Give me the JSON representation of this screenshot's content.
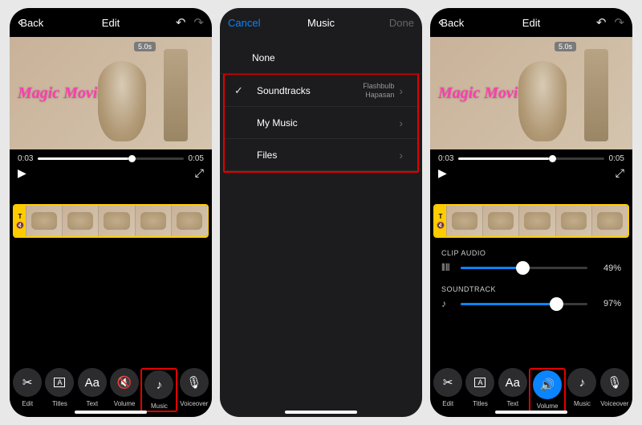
{
  "nav": {
    "back": "Back",
    "edit": "Edit",
    "music": "Music",
    "cancel": "Cancel",
    "done": "Done"
  },
  "video": {
    "overlay_text": "Magic Movie",
    "duration_badge": "5.0s",
    "time_start": "0:03",
    "time_end": "0:05",
    "progress_pct": 62
  },
  "music_list": {
    "none": "None",
    "items": [
      {
        "label": "Soundtracks",
        "sub1": "Flashbulb",
        "sub2": "Hapasan",
        "checked": true
      },
      {
        "label": "My Music"
      },
      {
        "label": "Files"
      }
    ]
  },
  "sliders": {
    "clip_audio": {
      "label": "CLIP AUDIO",
      "value": "49%",
      "pct": 49
    },
    "soundtrack": {
      "label": "SOUNDTRACK",
      "value": "97%",
      "pct": 75
    }
  },
  "tools": {
    "edit": "Edit",
    "titles": "Titles",
    "text": "Text",
    "volume": "Volume",
    "music": "Music",
    "voiceover": "Voiceover"
  }
}
